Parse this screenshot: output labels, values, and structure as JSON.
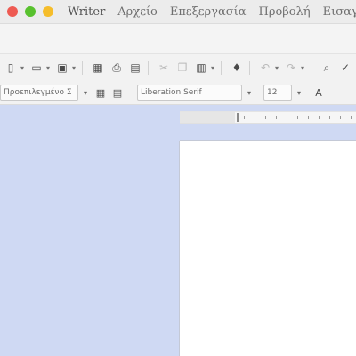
{
  "window": {
    "traffic_lights": [
      {
        "name": "close",
        "color": "#ee5a52"
      },
      {
        "name": "minimize",
        "color": "#f5bd2b"
      },
      {
        "name": "zoom",
        "color": "#58c12e"
      }
    ],
    "menu": [
      "Writer",
      "Αρχείο",
      "Επεξεργασία",
      "Προβολή",
      "Εισαγ"
    ]
  },
  "toolbar": {
    "items": [
      {
        "icon": "new-document-icon",
        "glyph": "▯",
        "dd": true
      },
      {
        "icon": "open-folder-icon",
        "glyph": "▭",
        "dd": true
      },
      {
        "icon": "save-icon",
        "glyph": "▣",
        "dd": true
      },
      {
        "sep": true
      },
      {
        "icon": "export-pdf-icon",
        "glyph": "▦"
      },
      {
        "icon": "print-icon",
        "glyph": "⎙"
      },
      {
        "icon": "print-preview-icon",
        "glyph": "▤"
      },
      {
        "sep": true
      },
      {
        "icon": "cut-icon",
        "glyph": "✂",
        "dim": true
      },
      {
        "icon": "copy-icon",
        "glyph": "❐",
        "dim": true
      },
      {
        "icon": "paste-icon",
        "glyph": "▥",
        "dd": true
      },
      {
        "sep": true
      },
      {
        "icon": "clone-formatting-icon",
        "glyph": "♦"
      },
      {
        "sep": true
      },
      {
        "icon": "undo-icon",
        "glyph": "↶",
        "dd": true,
        "dim": true
      },
      {
        "icon": "redo-icon",
        "glyph": "↷",
        "dd": true,
        "dim": true
      },
      {
        "sep": true
      },
      {
        "icon": "find-replace-icon",
        "glyph": "⌕"
      },
      {
        "icon": "spelling-icon",
        "glyph": "✓"
      }
    ]
  },
  "format": {
    "style_value": "Προεπιλεγμένο Σ",
    "font_value": "Liberation Serif",
    "size_value": "12",
    "style_icons": [
      "paragraph-style-update-icon",
      "new-style-icon"
    ],
    "style_glyphs": [
      "▦",
      "▤"
    ],
    "bold_icon_glyph": "A"
  },
  "colors": {
    "doc_background": "#cfd9f3",
    "page": "#ffffff"
  }
}
